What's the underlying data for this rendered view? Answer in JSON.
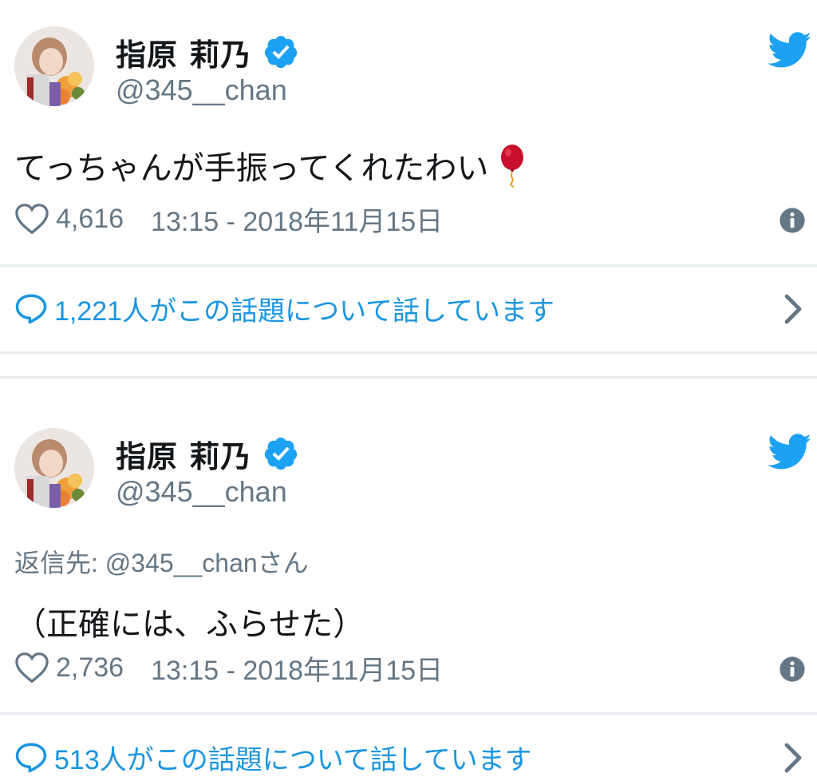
{
  "colors": {
    "link": "#1b95e0",
    "muted": "#657786",
    "text": "#14171a",
    "divider": "#e6ecf0"
  },
  "tweets": [
    {
      "author_name": "指原 莉乃",
      "handle": "@345__chan",
      "reply_to_label": "",
      "reply_to_handle": "",
      "reply_to_suffix": "",
      "text": "てっちゃんが手振ってくれたわい",
      "emoji": "balloon",
      "likes": "4,616",
      "timestamp": "13:15 - 2018年11月15日",
      "conversation": "1,221人がこの話題について話しています"
    },
    {
      "author_name": "指原 莉乃",
      "handle": "@345__chan",
      "reply_to_label": "返信先: ",
      "reply_to_handle": "@345__chan",
      "reply_to_suffix": "さん",
      "text": "（正確には、ふらせた）",
      "likes": "2,736",
      "timestamp": "13:15 - 2018年11月15日",
      "conversation": "513人がこの話題について話しています"
    }
  ],
  "icons": [
    "avatar",
    "verified-icon",
    "twitter-bird-icon",
    "balloon-emoji",
    "heart-icon",
    "info-icon",
    "reply-bubble-icon",
    "chevron-right-icon"
  ]
}
